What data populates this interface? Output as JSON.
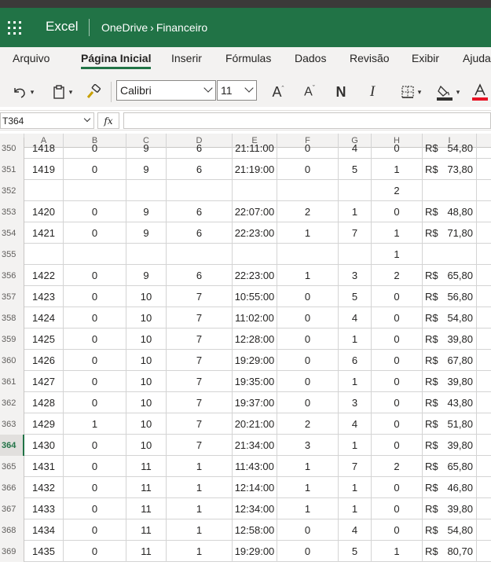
{
  "titlebar": {
    "app_name": "Excel",
    "location": "OneDrive",
    "separator": "›",
    "folder": "Financeiro",
    "accent": "#217346"
  },
  "ribbon_tabs": [
    {
      "label": "Arquivo",
      "active": false
    },
    {
      "label": "Página Inicial",
      "active": true
    },
    {
      "label": "Inserir",
      "active": false
    },
    {
      "label": "Fórmulas",
      "active": false
    },
    {
      "label": "Dados",
      "active": false
    },
    {
      "label": "Revisão",
      "active": false
    },
    {
      "label": "Exibir",
      "active": false
    },
    {
      "label": "Ajuda",
      "active": false
    }
  ],
  "toolbar": {
    "font_name": "Calibri",
    "font_size": "11",
    "bold_label": "N",
    "italic_label": "I",
    "font_color": "#e81123",
    "fill_color": "#323130"
  },
  "formula_bar": {
    "name_box": "T364",
    "fx_label": "fx",
    "formula": ""
  },
  "columns": [
    "A",
    "B",
    "C",
    "D",
    "E",
    "F",
    "G",
    "H",
    "I"
  ],
  "selected_row": "364",
  "rows": [
    {
      "num": "350",
      "A": "1418",
      "B": "0",
      "C": "9",
      "D": "6",
      "E": "21:11:00",
      "F": "0",
      "G": "4",
      "H": "0",
      "cur": "R$",
      "I": "54,80"
    },
    {
      "num": "351",
      "A": "1419",
      "B": "0",
      "C": "9",
      "D": "6",
      "E": "21:19:00",
      "F": "0",
      "G": "5",
      "H": "1",
      "cur": "R$",
      "I": "73,80"
    },
    {
      "num": "352",
      "A": "",
      "B": "",
      "C": "",
      "D": "",
      "E": "",
      "F": "",
      "G": "",
      "H": "2",
      "cur": "",
      "I": ""
    },
    {
      "num": "353",
      "A": "1420",
      "B": "0",
      "C": "9",
      "D": "6",
      "E": "22:07:00",
      "F": "2",
      "G": "1",
      "H": "0",
      "cur": "R$",
      "I": "48,80"
    },
    {
      "num": "354",
      "A": "1421",
      "B": "0",
      "C": "9",
      "D": "6",
      "E": "22:23:00",
      "F": "1",
      "G": "7",
      "H": "1",
      "cur": "R$",
      "I": "71,80"
    },
    {
      "num": "355",
      "A": "",
      "B": "",
      "C": "",
      "D": "",
      "E": "",
      "F": "",
      "G": "",
      "H": "1",
      "cur": "",
      "I": ""
    },
    {
      "num": "356",
      "A": "1422",
      "B": "0",
      "C": "9",
      "D": "6",
      "E": "22:23:00",
      "F": "1",
      "G": "3",
      "H": "2",
      "cur": "R$",
      "I": "65,80"
    },
    {
      "num": "357",
      "A": "1423",
      "B": "0",
      "C": "10",
      "D": "7",
      "E": "10:55:00",
      "F": "0",
      "G": "5",
      "H": "0",
      "cur": "R$",
      "I": "56,80"
    },
    {
      "num": "358",
      "A": "1424",
      "B": "0",
      "C": "10",
      "D": "7",
      "E": "11:02:00",
      "F": "0",
      "G": "4",
      "H": "0",
      "cur": "R$",
      "I": "54,80"
    },
    {
      "num": "359",
      "A": "1425",
      "B": "0",
      "C": "10",
      "D": "7",
      "E": "12:28:00",
      "F": "0",
      "G": "1",
      "H": "0",
      "cur": "R$",
      "I": "39,80"
    },
    {
      "num": "360",
      "A": "1426",
      "B": "0",
      "C": "10",
      "D": "7",
      "E": "19:29:00",
      "F": "0",
      "G": "6",
      "H": "0",
      "cur": "R$",
      "I": "67,80"
    },
    {
      "num": "361",
      "A": "1427",
      "B": "0",
      "C": "10",
      "D": "7",
      "E": "19:35:00",
      "F": "0",
      "G": "1",
      "H": "0",
      "cur": "R$",
      "I": "39,80"
    },
    {
      "num": "362",
      "A": "1428",
      "B": "0",
      "C": "10",
      "D": "7",
      "E": "19:37:00",
      "F": "0",
      "G": "3",
      "H": "0",
      "cur": "R$",
      "I": "43,80"
    },
    {
      "num": "363",
      "A": "1429",
      "B": "1",
      "C": "10",
      "D": "7",
      "E": "20:21:00",
      "F": "2",
      "G": "4",
      "H": "0",
      "cur": "R$",
      "I": "51,80"
    },
    {
      "num": "364",
      "A": "1430",
      "B": "0",
      "C": "10",
      "D": "7",
      "E": "21:34:00",
      "F": "3",
      "G": "1",
      "H": "0",
      "cur": "R$",
      "I": "39,80"
    },
    {
      "num": "365",
      "A": "1431",
      "B": "0",
      "C": "11",
      "D": "1",
      "E": "11:43:00",
      "F": "1",
      "G": "7",
      "H": "2",
      "cur": "R$",
      "I": "65,80"
    },
    {
      "num": "366",
      "A": "1432",
      "B": "0",
      "C": "11",
      "D": "1",
      "E": "12:14:00",
      "F": "1",
      "G": "1",
      "H": "0",
      "cur": "R$",
      "I": "46,80"
    },
    {
      "num": "367",
      "A": "1433",
      "B": "0",
      "C": "11",
      "D": "1",
      "E": "12:34:00",
      "F": "1",
      "G": "1",
      "H": "0",
      "cur": "R$",
      "I": "39,80"
    },
    {
      "num": "368",
      "A": "1434",
      "B": "0",
      "C": "11",
      "D": "1",
      "E": "12:58:00",
      "F": "0",
      "G": "4",
      "H": "0",
      "cur": "R$",
      "I": "54,80"
    },
    {
      "num": "369",
      "A": "1435",
      "B": "0",
      "C": "11",
      "D": "1",
      "E": "19:29:00",
      "F": "0",
      "G": "5",
      "H": "1",
      "cur": "R$",
      "I": "80,70"
    }
  ]
}
